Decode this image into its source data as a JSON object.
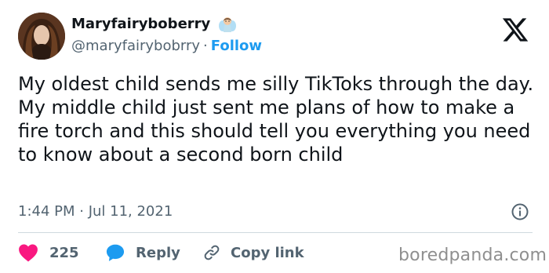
{
  "author": {
    "display_name": "Maryfairyboberry",
    "handle": "@maryfairybobrry",
    "separator": "·",
    "follow_label": "Follow"
  },
  "tweet": {
    "text": "My oldest child sends me silly TikToks through the day. My middle child just sent me plans of how to make a fire torch and this should tell you everything you need to know about a second born child",
    "timestamp": "1:44 PM · Jul 11, 2021"
  },
  "actions": {
    "like_count": "225",
    "reply_label": "Reply",
    "copy_label": "Copy link"
  },
  "watermark": "boredpanda.com",
  "colors": {
    "text": "#0f1419",
    "secondary": "#536471",
    "accent": "#1d9bf0",
    "like": "#f91880",
    "divider": "#cfd9de"
  },
  "icons": [
    "avatar-photo",
    "fairy-emoji",
    "x-logo-icon",
    "info-icon",
    "heart-icon",
    "reply-bubble-icon",
    "link-icon"
  ]
}
